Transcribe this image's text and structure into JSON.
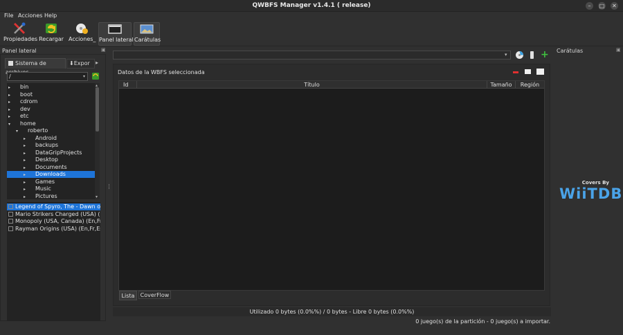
{
  "window": {
    "title": "QWBFS Manager v1.4.1 ( release)",
    "controls": [
      "–",
      "□",
      "✕"
    ]
  },
  "menu": [
    "File",
    "Acciones",
    "Help"
  ],
  "toolbar": [
    {
      "label": "Propiedades",
      "icon": "tools-icon"
    },
    {
      "label": "Recargar",
      "icon": "reload-icon"
    },
    {
      "label": "Acciones_",
      "icon": "actions-icon"
    },
    {
      "label": "Panel lateral",
      "icon": "side-panel-icon"
    },
    {
      "label": "Carátulas",
      "icon": "covers-icon"
    }
  ],
  "left_panel": {
    "title": "Panel lateral",
    "tabs": [
      "Sistema de archivos",
      "Expor"
    ],
    "path": "/",
    "tree": [
      {
        "label": "bin",
        "depth": 0,
        "expanded": false
      },
      {
        "label": "boot",
        "depth": 0,
        "expanded": false
      },
      {
        "label": "cdrom",
        "depth": 0,
        "expanded": false
      },
      {
        "label": "dev",
        "depth": 0,
        "expanded": false
      },
      {
        "label": "etc",
        "depth": 0,
        "expanded": false
      },
      {
        "label": "home",
        "depth": 0,
        "expanded": true
      },
      {
        "label": "roberto",
        "depth": 1,
        "expanded": true
      },
      {
        "label": "Android",
        "depth": 2,
        "expanded": false
      },
      {
        "label": "backups",
        "depth": 2,
        "expanded": false
      },
      {
        "label": "DataGripProjects",
        "depth": 2,
        "expanded": false
      },
      {
        "label": "Desktop",
        "depth": 2,
        "expanded": false
      },
      {
        "label": "Documents",
        "depth": 2,
        "expanded": false
      },
      {
        "label": "Downloads",
        "depth": 2,
        "expanded": false,
        "selected": true
      },
      {
        "label": "Games",
        "depth": 2,
        "expanded": false
      },
      {
        "label": "Music",
        "depth": 2,
        "expanded": false
      },
      {
        "label": "Pictures",
        "depth": 2,
        "expanded": false
      }
    ],
    "games": [
      {
        "label": "Legend of Spyro, The - Dawn of th",
        "selected": true
      },
      {
        "label": "Mario Strikers Charged (USA) (En,F",
        "selected": false
      },
      {
        "label": "Monopoly (USA, Canada) (En,Fr,Es)",
        "selected": false
      },
      {
        "label": "Rayman Origins (USA) (En,Fr,Es).wl",
        "selected": false
      }
    ]
  },
  "center": {
    "group_title": "Datos de la WBFS seleccionada",
    "columns": [
      "Id",
      "Título",
      "Tamaño",
      "Región"
    ],
    "view_tabs": [
      "Lista",
      "CoverFlow"
    ],
    "usage": "Utilizado 0 bytes (0.0%%) / 0 bytes - Libre 0 bytes (0.0%%)"
  },
  "status": "0 juego(s) de la partición - 0 juego(s) a importar.",
  "right_panel": {
    "title": "Carátulas",
    "covers_by": "Covers By",
    "logo": "WiiTDB"
  },
  "colors": {
    "selection": "#1e74d8",
    "logo": "#4aa3e8",
    "add": "#3fbf3f",
    "remove": "#e03030"
  }
}
